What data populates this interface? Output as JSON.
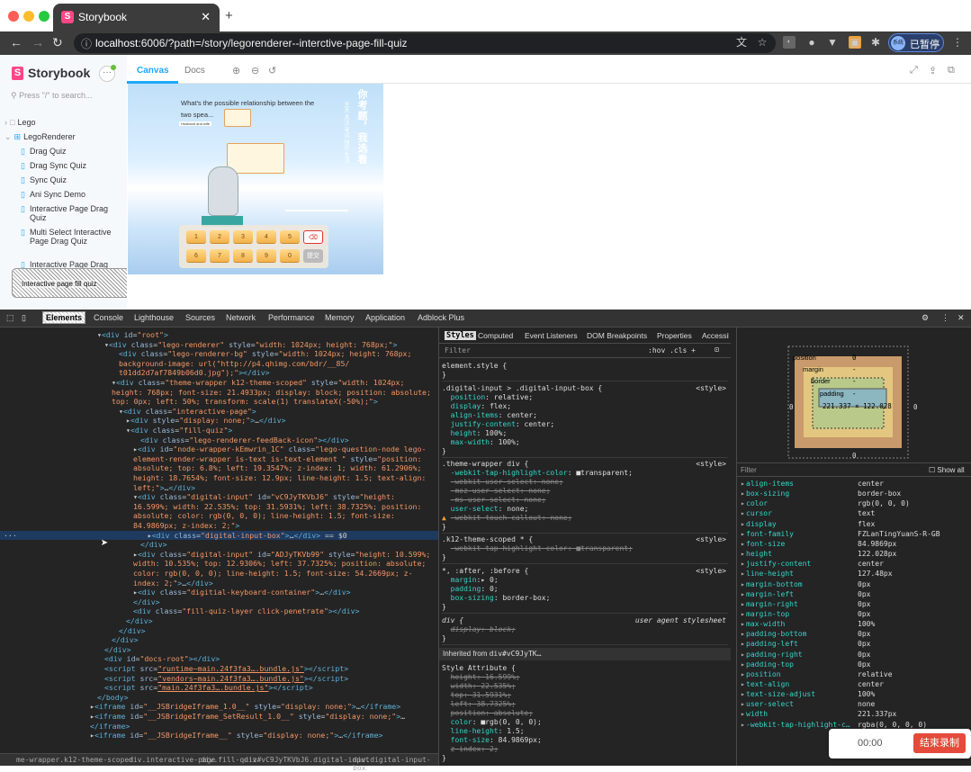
{
  "browser": {
    "tab_title": "Storybook",
    "url_host": "localhost",
    "url_rest": ":6006/?path=/story/legorenderer--interctive-page-fill-quiz",
    "profile_label": "已暂停",
    "profile_avatar": "系统"
  },
  "storybook": {
    "logo": "Storybook",
    "search_placeholder": "Press \"/\" to search...",
    "tree": [
      {
        "label": "Lego",
        "kind": "folder"
      },
      {
        "label": "LegoRenderer",
        "kind": "component"
      },
      {
        "label": "Drag Quiz",
        "kind": "story"
      },
      {
        "label": "Drag Sync Quiz",
        "kind": "story"
      },
      {
        "label": "Sync Quiz",
        "kind": "story"
      },
      {
        "label": "Ani Sync Demo",
        "kind": "story"
      },
      {
        "label": "Interactive Page Drag Quiz",
        "kind": "story"
      },
      {
        "label": "Multi Select Interactive Page Drag Quiz",
        "kind": "story"
      },
      {
        "label": "Interactive Page Drag",
        "kind": "story"
      }
    ],
    "overlay_text": "Interactive page fill quiz",
    "tabs": {
      "canvas": "Canvas",
      "docs": "Docs"
    },
    "quiz": {
      "question": "What's the possible relationship between the two spea...",
      "small_label": "Husband and wife",
      "vertical_title": "你考题，我选看",
      "vertical_sub": "天天·关注·考试·快乐·生活",
      "keys_row1": [
        "1",
        "2",
        "3",
        "4",
        "5",
        "⌫"
      ],
      "keys_row2": [
        "6",
        "7",
        "8",
        "9",
        "0",
        "提交"
      ]
    }
  },
  "devtools": {
    "tabs": [
      "Elements",
      "Console",
      "Lighthouse",
      "Sources",
      "Network",
      "Performance",
      "Memory",
      "Application",
      "Adblock Plus"
    ],
    "style_tabs": [
      "Styles",
      "Computed",
      "Event Listeners",
      "DOM Breakpoints",
      "Properties",
      "Accessibility"
    ],
    "filter_label": "Filter",
    "filter_extra": ":hov  .cls  +",
    "breadcrumbs": [
      "me-wrapper.k12-theme-scoped",
      "div.interactive-page",
      "div.fill-quiz",
      "div#vC9JyTKVbJ6.digital-input",
      "div.digital-input-box"
    ],
    "inherited_label": "Inherited from",
    "inherited_from": "div#vC9JyTK…",
    "computed_filter": "Filter",
    "show_all": "Show all",
    "boxmodel": {
      "position": "position",
      "position_val": "0",
      "margin": "margin",
      "margin_val": "-",
      "border": "border",
      "border_val": "-",
      "padding": "padding",
      "padding_val": "-",
      "content": "221.337 × 122.028",
      "side_zero": "0",
      "side_dash": "-"
    },
    "computed": [
      [
        "align-items",
        "center"
      ],
      [
        "box-sizing",
        "border-box"
      ],
      [
        "color",
        "rgb(0, 0, 0)"
      ],
      [
        "cursor",
        "text"
      ],
      [
        "display",
        "flex"
      ],
      [
        "font-family",
        "FZLanTingYuanS-R-GB"
      ],
      [
        "font-size",
        "84.9869px"
      ],
      [
        "height",
        "122.028px"
      ],
      [
        "justify-content",
        "center"
      ],
      [
        "line-height",
        "127.48px"
      ],
      [
        "margin-bottom",
        "0px"
      ],
      [
        "margin-left",
        "0px"
      ],
      [
        "margin-right",
        "0px"
      ],
      [
        "margin-top",
        "0px"
      ],
      [
        "max-width",
        "100%"
      ],
      [
        "padding-bottom",
        "0px"
      ],
      [
        "padding-left",
        "0px"
      ],
      [
        "padding-right",
        "0px"
      ],
      [
        "padding-top",
        "0px"
      ],
      [
        "position",
        "relative"
      ],
      [
        "text-align",
        "center"
      ],
      [
        "text-size-adjust",
        "100%"
      ],
      [
        "user-select",
        "none"
      ],
      [
        "width",
        "221.337px"
      ],
      [
        "-webkit-tap-highlight-c…",
        "rgba(0, 0, 0, 0)"
      ]
    ]
  },
  "recorder": {
    "time": "00:00",
    "stop_label": "结束录制"
  }
}
